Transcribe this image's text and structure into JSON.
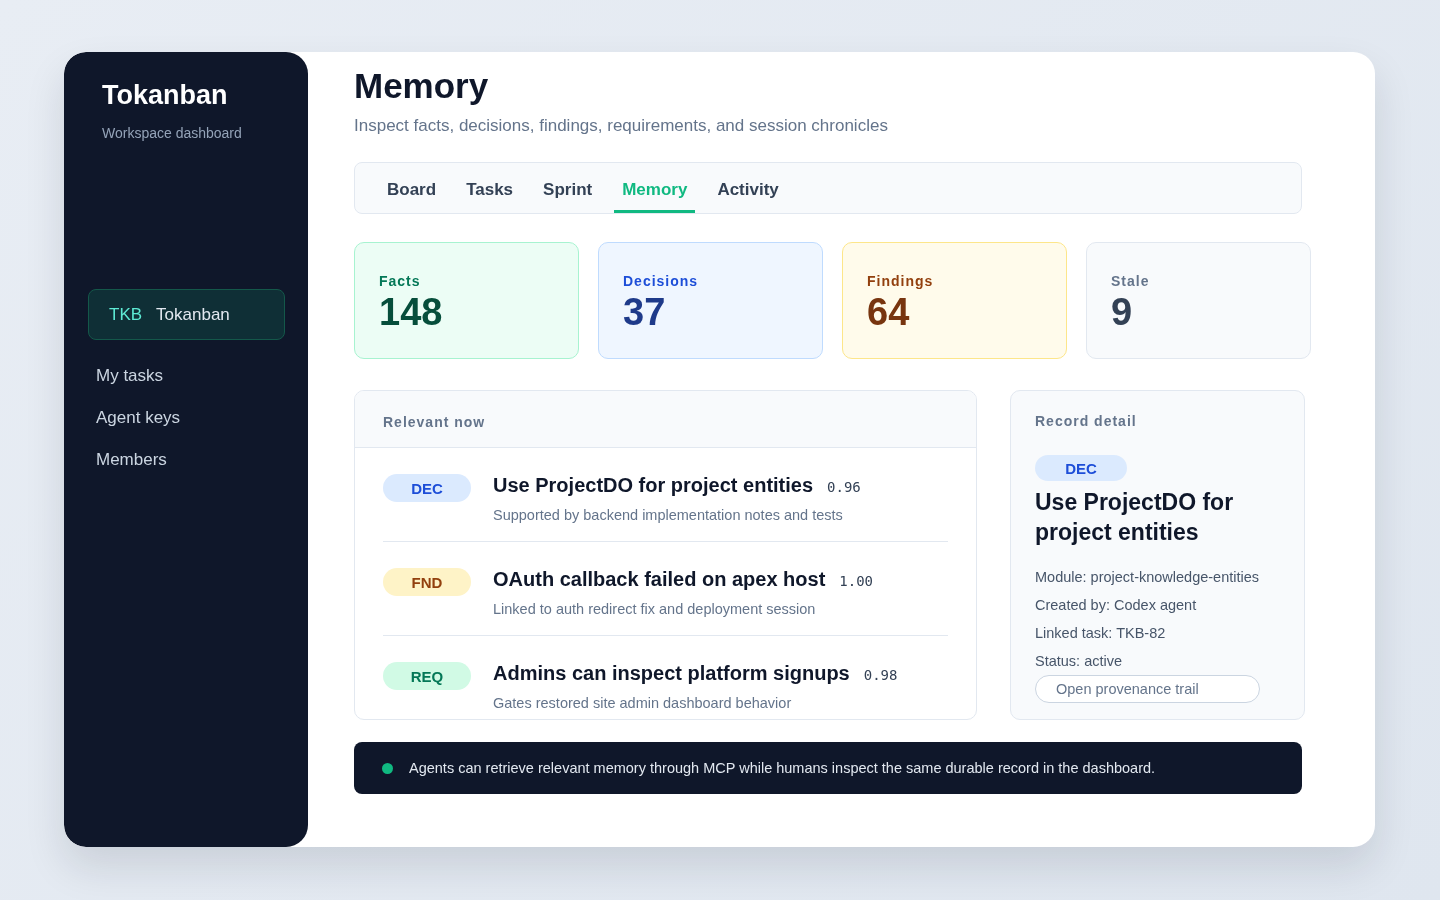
{
  "sidebar": {
    "brand": "Tokanban",
    "subtitle": "Workspace dashboard",
    "project": {
      "code": "TKB",
      "name": "Tokanban",
      "selected": true
    },
    "items": [
      {
        "label": "My tasks",
        "selected": false
      },
      {
        "label": "Agent keys",
        "selected": false
      },
      {
        "label": "Members",
        "selected": false
      }
    ]
  },
  "header": {
    "title": "Memory",
    "subtitle": "Inspect facts, decisions, findings, requirements, and session chronicles"
  },
  "tabs": [
    {
      "label": "Board",
      "selected": false
    },
    {
      "label": "Tasks",
      "selected": false
    },
    {
      "label": "Sprint",
      "selected": false
    },
    {
      "label": "Memory",
      "selected": true
    },
    {
      "label": "Activity",
      "selected": false
    }
  ],
  "stats": [
    {
      "kind": "green",
      "label": "Facts",
      "value": "148"
    },
    {
      "kind": "blue",
      "label": "Decisions",
      "value": "37"
    },
    {
      "kind": "amber",
      "label": "Findings",
      "value": "64"
    },
    {
      "kind": "gray",
      "label": "Stale",
      "value": "9"
    }
  ],
  "relevant": {
    "title": "Relevant now",
    "items": [
      {
        "kind": "blue",
        "tag": "DEC",
        "title": "Use ProjectDO for project entities",
        "score": "0.96",
        "note": "Supported by backend implementation notes and tests"
      },
      {
        "kind": "amber",
        "tag": "FND",
        "title": "OAuth callback failed on apex host",
        "score": "1.00",
        "note": "Linked to auth redirect fix and deployment session"
      },
      {
        "kind": "green",
        "tag": "REQ",
        "title": "Admins can inspect platform signups",
        "score": "0.98",
        "note": "Gates restored site admin dashboard behavior"
      }
    ]
  },
  "detail": {
    "heading": "Record detail",
    "kind": "blue",
    "tag": "DEC",
    "title": "Use ProjectDO for project entities",
    "fields": [
      "Module: project-knowledge-entities",
      "Created by: Codex agent",
      "Linked task: TKB-82",
      "Status: active"
    ],
    "button": "Open provenance trail"
  },
  "banner": {
    "text": "Agents can retrieve relevant memory through MCP while humans inspect the same durable record in the dashboard."
  }
}
